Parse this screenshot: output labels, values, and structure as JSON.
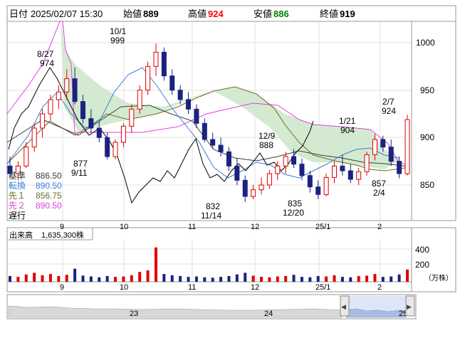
{
  "header": {
    "date_label": "日付",
    "datetime": "2025/02/07 15:30",
    "open_label": "始値",
    "open_value": "889",
    "high_label": "高値",
    "high_value": "924",
    "low_label": "安値",
    "low_value": "886",
    "close_label": "終値",
    "close_value": "919"
  },
  "colors": {
    "up": "#e00000",
    "down": "#1a237e",
    "kijun": "#3c3c3c",
    "tenkan": "#3b7dd8",
    "span1": "#6b6b2a",
    "span2": "#e040e0",
    "chikou": "#000000",
    "cloud": "#cfe8c8",
    "accent_high": "#ff0000",
    "accent_low": "#008000"
  },
  "price_axis": {
    "ticks": [
      "1000",
      "950",
      "900",
      "850"
    ]
  },
  "month_axis": {
    "labels": [
      "9",
      "10",
      "11",
      "12",
      "25/1",
      "2"
    ]
  },
  "indicators": {
    "kijun_label": "基準",
    "kijun_value": "886.50",
    "tenkan_label": "転換",
    "tenkan_value": "890.50",
    "span1_label": "先１",
    "span1_value": "856.75",
    "span2_label": "先２",
    "span2_value": "890.50",
    "chikou_label": "遅行"
  },
  "annotations": [
    {
      "date": "8/27",
      "value": "974"
    },
    {
      "date": "10/1",
      "value": "999"
    },
    {
      "date": "877",
      "value": "9/11"
    },
    {
      "date": "832",
      "value": "11/14"
    },
    {
      "date": "12/9",
      "value": "888"
    },
    {
      "date": "835",
      "value": "12/20"
    },
    {
      "date": "1/21",
      "value": "904"
    },
    {
      "date": "2/7",
      "value": "924"
    },
    {
      "date": "857",
      "value": "2/4"
    }
  ],
  "volume": {
    "label": "出来高",
    "value": "1,635,300株",
    "ticks": [
      "400",
      "200"
    ],
    "unit": "（万株）"
  },
  "navigator": {
    "labels": [
      "23",
      "24",
      "25"
    ],
    "left_arrow": "◀",
    "right_arrow": "▶"
  },
  "chart_data": {
    "type": "candlestick",
    "title": "",
    "ylim": [
      820,
      1020
    ],
    "x_months": [
      "9",
      "10",
      "11",
      "12",
      "25/1",
      "2"
    ],
    "candles": [
      {
        "o": 870,
        "h": 880,
        "l": 858,
        "c": 862
      },
      {
        "o": 862,
        "h": 875,
        "l": 855,
        "c": 870
      },
      {
        "o": 870,
        "h": 895,
        "l": 868,
        "c": 890
      },
      {
        "o": 890,
        "h": 915,
        "l": 885,
        "c": 910
      },
      {
        "o": 910,
        "h": 930,
        "l": 900,
        "c": 925
      },
      {
        "o": 925,
        "h": 945,
        "l": 918,
        "c": 940
      },
      {
        "o": 940,
        "h": 955,
        "l": 930,
        "c": 948
      },
      {
        "o": 948,
        "h": 972,
        "l": 940,
        "c": 962
      },
      {
        "o": 962,
        "h": 974,
        "l": 935,
        "c": 938
      },
      {
        "o": 938,
        "h": 945,
        "l": 915,
        "c": 920
      },
      {
        "o": 920,
        "h": 930,
        "l": 905,
        "c": 910
      },
      {
        "o": 910,
        "h": 918,
        "l": 895,
        "c": 900
      },
      {
        "o": 900,
        "h": 905,
        "l": 877,
        "c": 880
      },
      {
        "o": 880,
        "h": 898,
        "l": 877,
        "c": 895
      },
      {
        "o": 895,
        "h": 915,
        "l": 890,
        "c": 912
      },
      {
        "o": 912,
        "h": 935,
        "l": 905,
        "c": 930
      },
      {
        "o": 930,
        "h": 955,
        "l": 925,
        "c": 950
      },
      {
        "o": 950,
        "h": 980,
        "l": 945,
        "c": 975
      },
      {
        "o": 975,
        "h": 999,
        "l": 965,
        "c": 990
      },
      {
        "o": 990,
        "h": 995,
        "l": 960,
        "c": 965
      },
      {
        "o": 965,
        "h": 972,
        "l": 945,
        "c": 950
      },
      {
        "o": 950,
        "h": 955,
        "l": 935,
        "c": 940
      },
      {
        "o": 940,
        "h": 948,
        "l": 925,
        "c": 930
      },
      {
        "o": 930,
        "h": 935,
        "l": 910,
        "c": 915
      },
      {
        "o": 915,
        "h": 920,
        "l": 895,
        "c": 898
      },
      {
        "o": 898,
        "h": 905,
        "l": 888,
        "c": 892
      },
      {
        "o": 892,
        "h": 900,
        "l": 880,
        "c": 885
      },
      {
        "o": 885,
        "h": 890,
        "l": 865,
        "c": 870
      },
      {
        "o": 870,
        "h": 878,
        "l": 850,
        "c": 855
      },
      {
        "o": 855,
        "h": 860,
        "l": 832,
        "c": 838
      },
      {
        "o": 838,
        "h": 850,
        "l": 835,
        "c": 845
      },
      {
        "o": 845,
        "h": 858,
        "l": 840,
        "c": 850
      },
      {
        "o": 850,
        "h": 866,
        "l": 846,
        "c": 862
      },
      {
        "o": 862,
        "h": 875,
        "l": 855,
        "c": 870
      },
      {
        "o": 870,
        "h": 885,
        "l": 862,
        "c": 880
      },
      {
        "o": 880,
        "h": 888,
        "l": 868,
        "c": 872
      },
      {
        "o": 872,
        "h": 878,
        "l": 855,
        "c": 860
      },
      {
        "o": 860,
        "h": 865,
        "l": 842,
        "c": 848
      },
      {
        "o": 848,
        "h": 855,
        "l": 835,
        "c": 840
      },
      {
        "o": 840,
        "h": 862,
        "l": 838,
        "c": 858
      },
      {
        "o": 858,
        "h": 875,
        "l": 852,
        "c": 870
      },
      {
        "o": 870,
        "h": 882,
        "l": 860,
        "c": 865
      },
      {
        "o": 865,
        "h": 872,
        "l": 852,
        "c": 856
      },
      {
        "o": 856,
        "h": 868,
        "l": 850,
        "c": 864
      },
      {
        "o": 864,
        "h": 885,
        "l": 860,
        "c": 882
      },
      {
        "o": 882,
        "h": 904,
        "l": 876,
        "c": 898
      },
      {
        "o": 898,
        "h": 902,
        "l": 885,
        "c": 890
      },
      {
        "o": 890,
        "h": 898,
        "l": 870,
        "c": 875
      },
      {
        "o": 875,
        "h": 880,
        "l": 857,
        "c": 862
      },
      {
        "o": 862,
        "h": 924,
        "l": 860,
        "c": 919
      }
    ],
    "volume": [
      70,
      60,
      90,
      110,
      80,
      95,
      70,
      85,
      160,
      75,
      65,
      55,
      70,
      60,
      65,
      80,
      120,
      140,
      420,
      95,
      80,
      70,
      60,
      65,
      55,
      50,
      60,
      70,
      90,
      110,
      75,
      60,
      55,
      65,
      70,
      85,
      60,
      55,
      70,
      65,
      80,
      60,
      55,
      70,
      75,
      95,
      60,
      65,
      90,
      150
    ]
  }
}
